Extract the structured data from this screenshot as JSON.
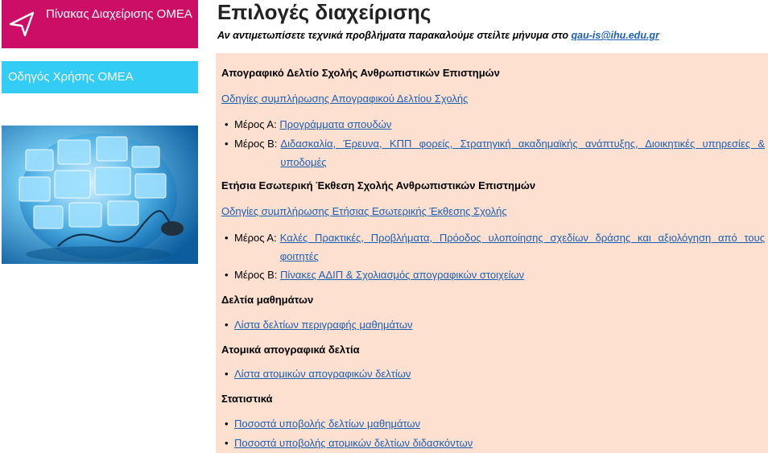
{
  "sidebar": {
    "dashboard_label": "Πίνακας Διαχείρισης ΟΜΕΑ",
    "guide_label": "Οδηγός Χρήσης ΟΜΕΑ"
  },
  "main": {
    "title": "Επιλογές διαχείρισης",
    "notice_text": "Αν αντιμετωπίσετε τεχνικά προβλήματα παρακαλούμε στείλτε μήνυμα στο ",
    "notice_email": "qau-is@ihu.edu.gr",
    "sections": [
      {
        "heading": "Απογραφικό Δελτίο Σχολής Ανθρωπιστικών Επιστημών",
        "instructions": "Οδηγίες συμπλήρωσης Απογραφικού Δελτίου Σχολής",
        "items": [
          {
            "prefix": "Μέρος Α:",
            "link": "Προγράμματα σπουδών"
          },
          {
            "prefix": "Μέρος Β:",
            "link": "Διδασκαλία, Έρευνα, ΚΠΠ φορείς, Στρατηγική ακαδημαϊκής ανάπτυξης, Διοικητικές υπηρεσίες & υποδομές"
          }
        ]
      },
      {
        "heading": "Ετήσια Εσωτερική Έκθεση Σχολής Ανθρωπιστικών Επιστημών",
        "instructions": "Οδηγίες συμπλήρωσης Ετήσιας Εσωτερικής Έκθεσης Σχολής",
        "items": [
          {
            "prefix": "Μέρος Α:",
            "link": "Καλές Πρακτικές, Προβλήματα, Πρόοδος υλοποίησης σχεδίων δράσης και αξιολόγηση από τους φοιτητές"
          },
          {
            "prefix": "Μέρος Β:",
            "link": "Πίνακες ΑΔΙΠ & Σχολιασμός απογραφικών στοιχείων"
          }
        ]
      },
      {
        "heading": "Δελτία μαθημάτων",
        "items": [
          {
            "link": "Λίστα δελτίων περιγραφής μαθημάτων"
          }
        ]
      },
      {
        "heading": "Ατομικά απογραφικά δελτία",
        "items": [
          {
            "link": "Λίστα ατομικών απογραφικών δελτίων"
          }
        ]
      },
      {
        "heading": "Στατιστικά",
        "items": [
          {
            "link": "Ποσοστά υποβολής δελτίων μαθημάτων"
          },
          {
            "link": "Ποσοστά υποβολής ατομικών δελτίων διδασκόντων"
          }
        ]
      }
    ]
  },
  "colors": {
    "dashboard_bg": "#cc0e66",
    "guide_bg": "#33ccf5",
    "panel_bg": "#fde0cf",
    "link": "#1a5fb4"
  },
  "icons": {
    "dashboard": "navigation-arrow-icon",
    "hero": "globe-media-image"
  }
}
